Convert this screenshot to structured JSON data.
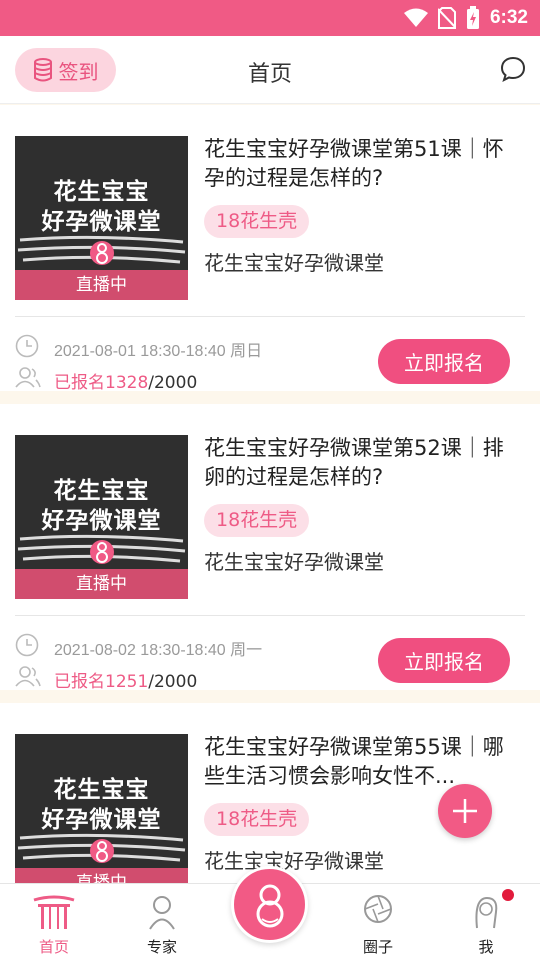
{
  "status_bar": {
    "time": "6:32"
  },
  "header": {
    "checkin_label": "签到",
    "title": "首页"
  },
  "courses": [
    {
      "thumb_line1": "花生宝宝",
      "thumb_line2": "好孕微课堂",
      "live_label": "直播中",
      "title": "花生宝宝好孕微课堂第51课｜怀孕的过程是怎样的?",
      "price": "18花生壳",
      "source": "花生宝宝好孕微课堂",
      "schedule": "2021-08-01 18:30-18:40 周日",
      "enroll_prefix": "已报名",
      "enroll_count": "1328",
      "enroll_total": "/2000",
      "signup_label": "立即报名"
    },
    {
      "thumb_line1": "花生宝宝",
      "thumb_line2": "好孕微课堂",
      "live_label": "直播中",
      "title": "花生宝宝好孕微课堂第52课｜排卵的过程是怎样的?",
      "price": "18花生壳",
      "source": "花生宝宝好孕微课堂",
      "schedule": "2021-08-02 18:30-18:40 周一",
      "enroll_prefix": "已报名",
      "enroll_count": "1251",
      "enroll_total": "/2000",
      "signup_label": "立即报名"
    },
    {
      "thumb_line1": "花生宝宝",
      "thumb_line2": "好孕微课堂",
      "live_label": "直播中",
      "title": "花生宝宝好孕微课堂第55课｜哪些生活习惯会影响女性不...",
      "price": "18花生壳",
      "source": "花生宝宝好孕微课堂"
    }
  ],
  "tabs": [
    {
      "label": "首页",
      "icon": "gate-icon",
      "active": true
    },
    {
      "label": "专家",
      "icon": "expert-icon",
      "active": false
    },
    {
      "label": "圈子",
      "icon": "aperture-icon",
      "active": false
    },
    {
      "label": "我",
      "icon": "profile-icon",
      "active": false
    }
  ],
  "colors": {
    "brand": "#f05a85",
    "price_bg": "#fcdfe7",
    "background": "#fdf7ec"
  }
}
